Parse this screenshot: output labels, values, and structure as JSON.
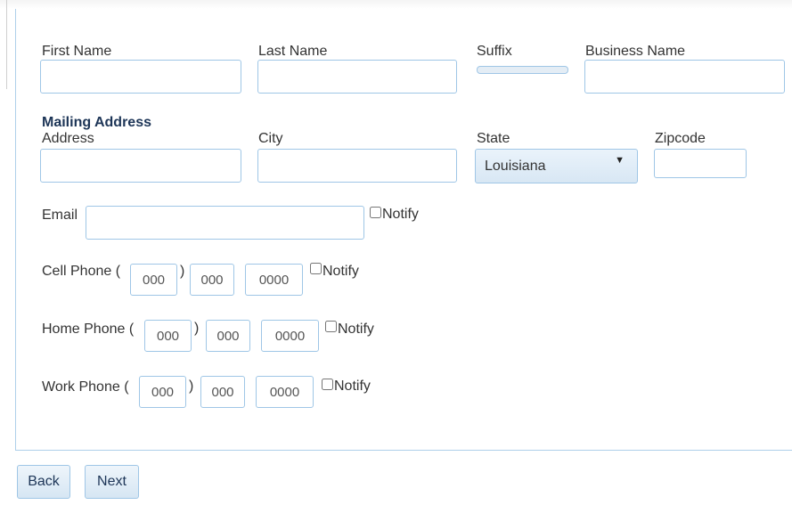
{
  "labels": {
    "first_name": "First Name",
    "last_name": "Last Name",
    "suffix": "Suffix",
    "business_name": "Business Name",
    "mailing_address": "Mailing Address",
    "address": "Address",
    "city": "City",
    "state": "State",
    "zipcode": "Zipcode",
    "email": "Email",
    "notify": "Notify",
    "cell_phone": "Cell Phone (",
    "home_phone": "Home Phone (",
    "work_phone": "Work Phone (",
    "close_paren": ")"
  },
  "fields": {
    "first_name": "",
    "last_name": "",
    "business_name": "",
    "address": "",
    "city": "",
    "state_selected": "Louisiana",
    "zipcode": "",
    "email": ""
  },
  "phone_placeholders": {
    "area": "000",
    "prefix": "000",
    "line": "0000"
  },
  "notify_checked": {
    "email": false,
    "cell": false,
    "home": false,
    "work": false
  },
  "buttons": {
    "back": "Back",
    "next": "Next"
  },
  "icons": {
    "state_dropdown": "caret-down-icon"
  }
}
